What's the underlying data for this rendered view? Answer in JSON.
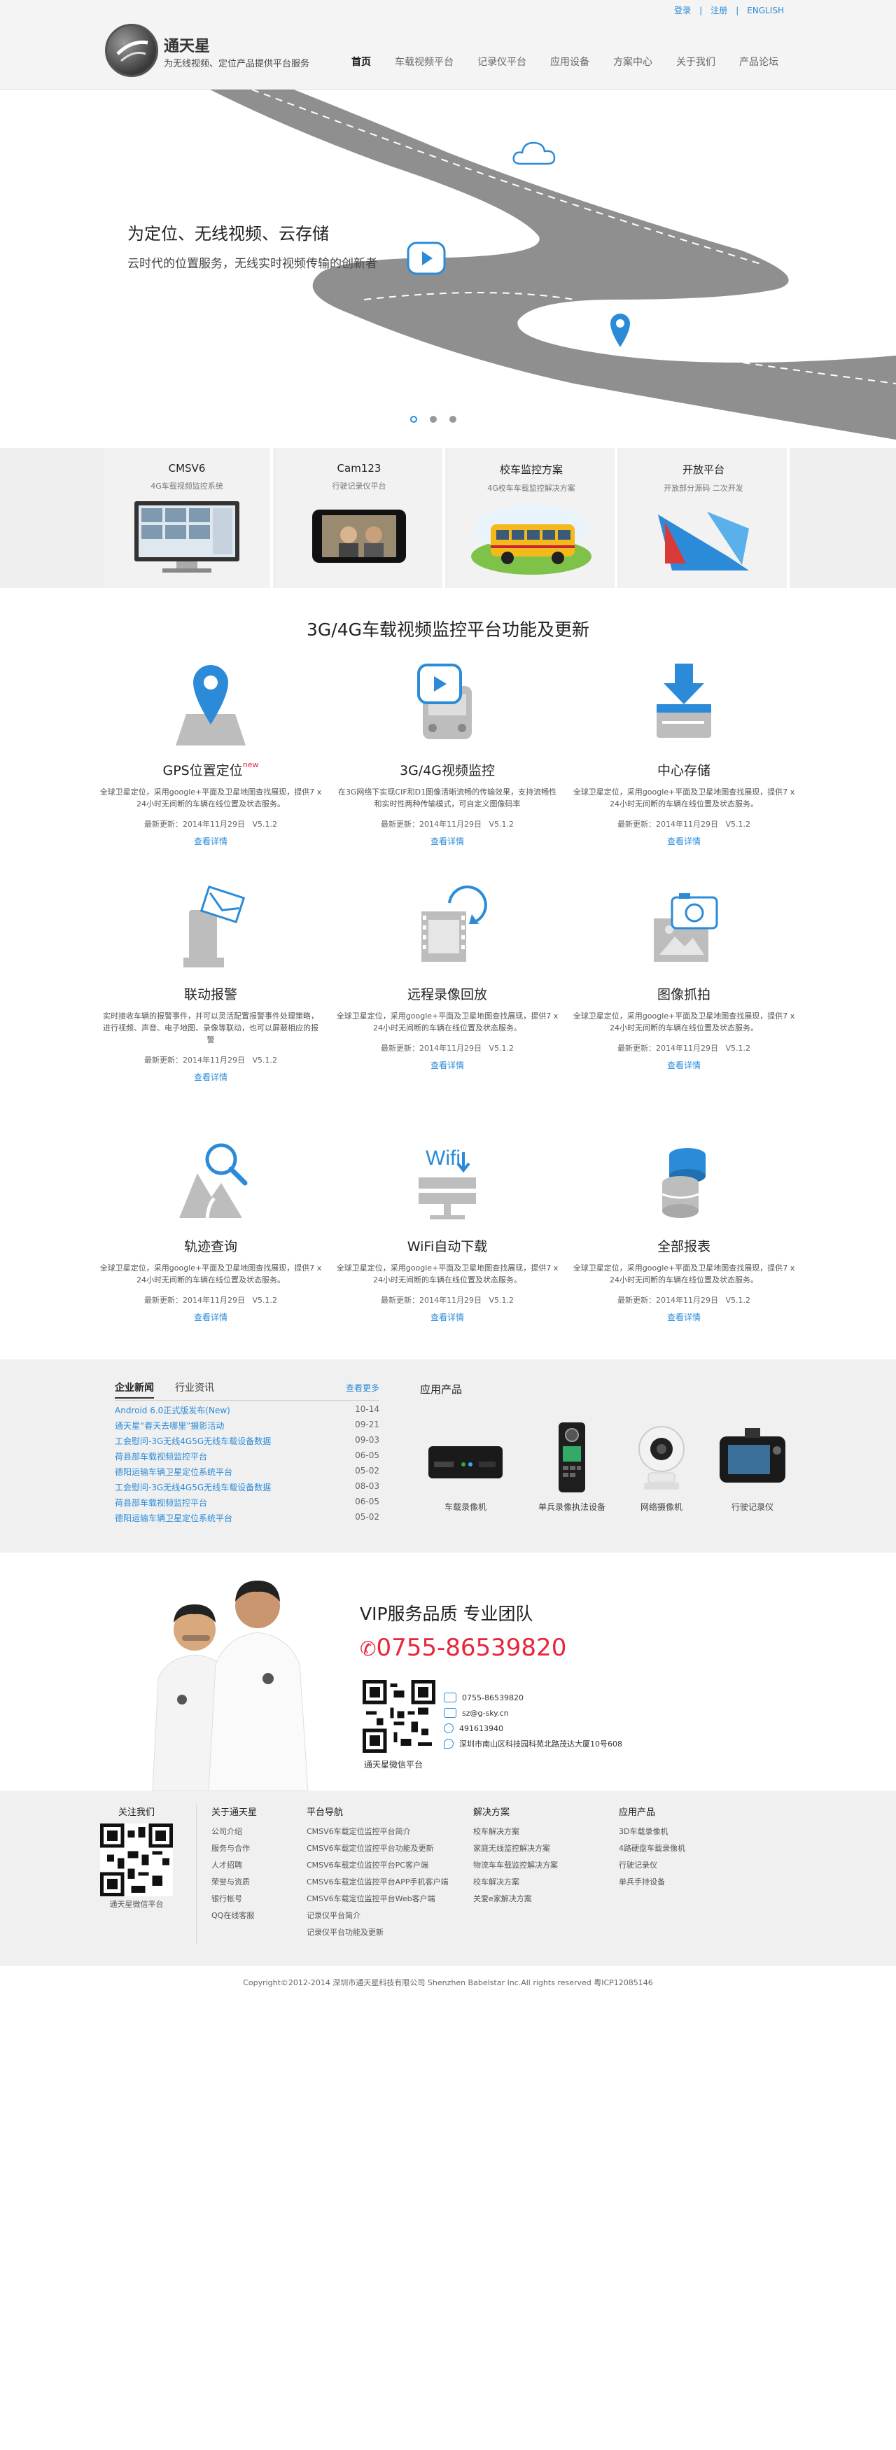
{
  "header": {
    "top_links": {
      "login": "登录",
      "register": "注册",
      "english": "ENGLISH"
    },
    "brand_name": "通天星",
    "tagline": "为无线视频、定位产品提供平台服务",
    "nav": [
      "首页",
      "车载视频平台",
      "记录仪平台",
      "应用设备",
      "方案中心",
      "关于我们",
      "产品论坛"
    ]
  },
  "hero": {
    "title": "为定位、无线视频、云存储",
    "subtitle": "云时代的位置服务，无线实时视频传输的创新者",
    "slides": 3,
    "active_slide": 1
  },
  "products": [
    {
      "title": "CMSV6",
      "sub": "4G车载视频监控系统"
    },
    {
      "title": "Cam123",
      "sub": "行驶记录仪平台"
    },
    {
      "title": "校车监控方案",
      "sub": "4G校车车载监控解决方案"
    },
    {
      "title": "开放平台",
      "sub": "开放部分源码 二次开发"
    }
  ],
  "features_title": "3G/4G车载视频监控平台功能及更新",
  "features": [
    {
      "name": "GPS位置定位",
      "badge": "new",
      "desc": "全球卫星定位，采用google+平面及卫星地图查找展现，提供7 x 24小时无间断的车辆在线位置及状态服务。",
      "updated": "最新更新：2014年11月29日",
      "version": "V5.1.2",
      "link": "查看详情",
      "icon": "map-pin-icon"
    },
    {
      "name": "3G/4G视频监控",
      "badge": "",
      "desc": "在3G网络下实现CIF和D1图像清晰流畅的传输效果，支持流畅性和实时性两种传输模式，可自定义图像码率",
      "updated": "最新更新：2014年11月29日",
      "version": "V5.1.2",
      "link": "查看详情",
      "icon": "bus-video-icon"
    },
    {
      "name": "中心存储",
      "badge": "",
      "desc": "全球卫星定位，采用google+平面及卫星地图查找展现，提供7 x 24小时无间断的车辆在线位置及状态服务。",
      "updated": "最新更新：2014年11月29日",
      "version": "V5.1.2",
      "link": "查看详情",
      "icon": "download-storage-icon"
    },
    {
      "name": "联动报警",
      "badge": "",
      "desc": "实时接收车辆的报警事件，并可以灵活配置报警事件处理策略，进行视频、声音、电子地图、录像等联动，也可以屏蔽相应的报警",
      "updated": "最新更新：2014年11月29日",
      "version": "V5.1.2",
      "link": "查看详情",
      "icon": "alarm-mail-icon"
    },
    {
      "name": "远程录像回放",
      "badge": "",
      "desc": "全球卫星定位，采用google+平面及卫星地图查找展现，提供7 x 24小时无间断的车辆在线位置及状态服务。",
      "updated": "最新更新：2014年11月29日",
      "version": "V5.1.2",
      "link": "查看详情",
      "icon": "replay-film-icon"
    },
    {
      "name": "图像抓拍",
      "badge": "",
      "desc": "全球卫星定位，采用google+平面及卫星地图查找展现，提供7 x 24小时无间断的车辆在线位置及状态服务。",
      "updated": "最新更新：2014年11月29日",
      "version": "V5.1.2",
      "link": "查看详情",
      "icon": "camera-photo-icon"
    },
    {
      "name": "轨迹查询",
      "badge": "",
      "desc": "全球卫星定位，采用google+平面及卫星地图查找展现，提供7 x 24小时无间断的车辆在线位置及状态服务。",
      "updated": "最新更新：2014年11月29日",
      "version": "V5.1.2",
      "link": "查看详情",
      "icon": "track-search-icon"
    },
    {
      "name": "WiFi自动下载",
      "badge": "",
      "desc": "全球卫星定位，采用google+平面及卫星地图查找展现，提供7 x 24小时无间断的车辆在线位置及状态服务。",
      "updated": "最新更新：2014年11月29日",
      "version": "V5.1.2",
      "link": "查看详情",
      "icon": "wifi-download-icon"
    },
    {
      "name": "全部报表",
      "badge": "",
      "desc": "全球卫星定位，采用google+平面及卫星地图查找展现，提供7 x 24小时无间断的车辆在线位置及状态服务。",
      "updated": "最新更新：2014年11月29日",
      "version": "V5.1.2",
      "link": "查看详情",
      "icon": "database-report-icon"
    }
  ],
  "news": {
    "tabs": [
      "企业新闻",
      "行业资讯"
    ],
    "more": "查看更多",
    "items": [
      {
        "title": "Android 6.0正式版发布(New)",
        "date": "10-14"
      },
      {
        "title": "通天星“春天去哪里”摄影活动",
        "date": "09-21"
      },
      {
        "title": "工会慰问-3G无线4G5G无线车载设备数据",
        "date": "09-03"
      },
      {
        "title": "荷县部车载视频监控平台",
        "date": "06-05"
      },
      {
        "title": "德阳运输车辆卫星定位系统平台",
        "date": "05-02"
      },
      {
        "title": "工会慰问-3G无线4G5G无线车载设备数据",
        "date": "08-03"
      },
      {
        "title": "荷县部车载视频监控平台",
        "date": "06-05"
      },
      {
        "title": "德阳运输车辆卫星定位系统平台",
        "date": "05-02"
      }
    ]
  },
  "apps": {
    "title": "应用产品",
    "items": [
      "车载录像机",
      "单兵录像执法设备",
      "网络摄像机",
      "行驶记录仪"
    ]
  },
  "vip": {
    "title": "VIP服务品质 专业团队",
    "phone": "0755-86539820",
    "qr_caption": "通天星微信平台",
    "contacts": [
      {
        "icon": "phone-icon",
        "text": "0755-86539820"
      },
      {
        "icon": "mail-icon",
        "text": "sz@g-sky.cn"
      },
      {
        "icon": "qq-icon",
        "text": "491613940"
      },
      {
        "icon": "location-icon",
        "text": "深圳市南山区科技园科苑北路茂达大厦10号608"
      }
    ]
  },
  "footer": {
    "follow": {
      "title": "关注我们",
      "caption": "通天星微信平台"
    },
    "columns": [
      {
        "title": "关于通天星",
        "items": [
          "公司介绍",
          "服务与合作",
          "人才招聘",
          "荣誉与资质",
          "银行帐号",
          "QQ在线客服"
        ]
      },
      {
        "title": "平台导航",
        "items": [
          "CMSV6车载定位监控平台简介",
          "CMSV6车载定位监控平台功能及更新",
          "CMSV6车载定位监控平台PC客户端",
          "CMSV6车载定位监控平台APP手机客户端",
          "CMSV6车载定位监控平台Web客户端",
          "记录仪平台简介",
          "记录仪平台功能及更新"
        ]
      },
      {
        "title": "解决方案",
        "items": [
          "校车解决方案",
          "家庭无线监控解决方案",
          "物流车车载监控解决方案",
          "校车解决方案",
          "关爱e家解决方案"
        ]
      },
      {
        "title": "应用产品",
        "items": [
          "3D车载录像机",
          "4路硬盘车载录像机",
          "行驶记录仪",
          "单兵手持设备"
        ]
      }
    ],
    "copyright": "Copyright©2012-2014 深圳市通天星科技有限公司 Shenzhen Babelstar Inc.All rights reserved 粤ICP12085146"
  },
  "colors": {
    "accent": "#2b8bd8",
    "phone_red": "#e8263a",
    "band_gray": "#f0f0f0"
  }
}
